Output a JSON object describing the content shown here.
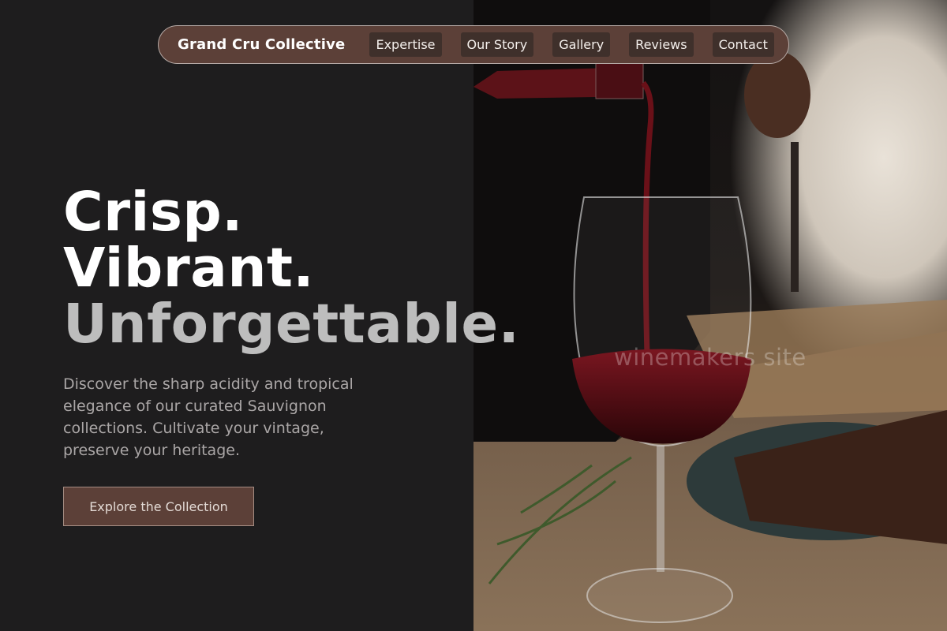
{
  "nav": {
    "brand": "Grand Cru Collective",
    "links": [
      "Expertise",
      "Our Story",
      "Gallery",
      "Reviews",
      "Contact"
    ]
  },
  "hero": {
    "line1": "Crisp.",
    "line2": "Vibrant.",
    "line3": "Unforgettable.",
    "description": "Discover the sharp acidity and tropical elegance of our curated Sauvignon collections. Cultivate your vintage, preserve your heritage.",
    "cta_label": "Explore the Collection"
  },
  "photo": {
    "watermark": "winemakers site",
    "subject": "red wine pouring into a glass on a wooden table"
  },
  "colors": {
    "page_background": "#1e1d1e",
    "brand_brown": "#5c4038",
    "nav_link_bg": "#3f302b",
    "headline_primary": "#ffffff",
    "headline_muted": "#bdbdbd",
    "body_text": "#aaa6a6"
  }
}
